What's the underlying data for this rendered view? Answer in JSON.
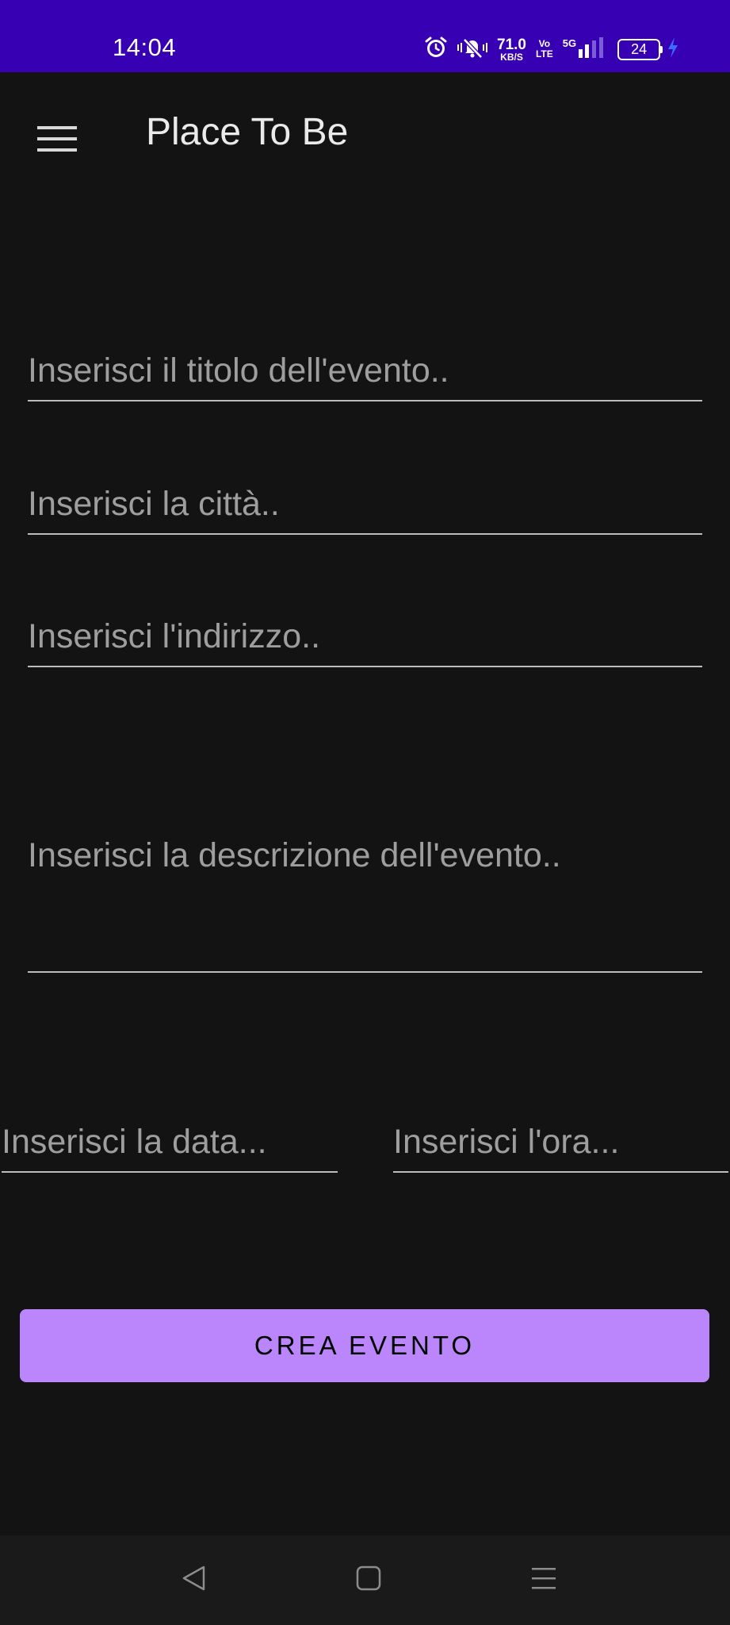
{
  "status_bar": {
    "time": "14:04",
    "speed_value": "71.0",
    "speed_unit": "KB/S",
    "volte_top": "Vo",
    "volte_bottom": "LTE",
    "network": "5G",
    "battery_level": "24",
    "icons": [
      "alarm-icon",
      "mute-icon",
      "signal-icon",
      "battery-icon",
      "charging-icon"
    ]
  },
  "app_bar": {
    "title": "Place To Be",
    "menu_icon": "hamburger-menu-icon"
  },
  "form": {
    "title_placeholder": "Inserisci il titolo dell'evento..",
    "city_placeholder": "Inserisci la città..",
    "address_placeholder": "Inserisci l'indirizzo..",
    "description_placeholder": "Inserisci la descrizione dell'evento..",
    "date_placeholder": "Inserisci la data...",
    "time_placeholder": "Inserisci l'ora..."
  },
  "actions": {
    "create_label": "CREA EVENTO"
  },
  "nav_bar": {
    "icons": [
      "back-icon",
      "home-icon",
      "recents-icon"
    ]
  },
  "colors": {
    "status_bar": "#3700b3",
    "background": "#131313",
    "accent": "#bb86fc",
    "nav_bar": "#1a1a1a"
  }
}
